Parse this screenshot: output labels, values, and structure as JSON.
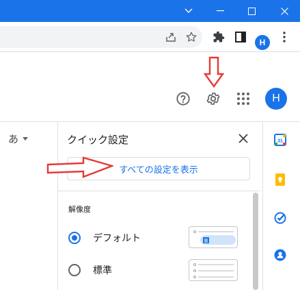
{
  "browser": {
    "profile_initial": "H"
  },
  "app_header": {
    "avatar_initial": "H"
  },
  "input_mode": {
    "label": "あ"
  },
  "quick_settings": {
    "title": "クイック設定",
    "all_settings_label": "すべての設定を表示",
    "density_section_label": "解像度",
    "options": [
      {
        "label": "デフォルト",
        "selected": true
      },
      {
        "label": "標準",
        "selected": false
      }
    ]
  },
  "colors": {
    "accent": "#1a73e8",
    "annotation_arrow": "#e53935"
  },
  "icons": [
    "chevron-down-icon",
    "restore-icon",
    "close-icon",
    "share-icon",
    "star-icon",
    "extensions-icon",
    "sidepanel-icon",
    "more-vert-icon",
    "help-icon",
    "gear-icon",
    "apps-grid-icon",
    "calendar-icon",
    "keep-icon",
    "tasks-icon",
    "contacts-icon"
  ]
}
